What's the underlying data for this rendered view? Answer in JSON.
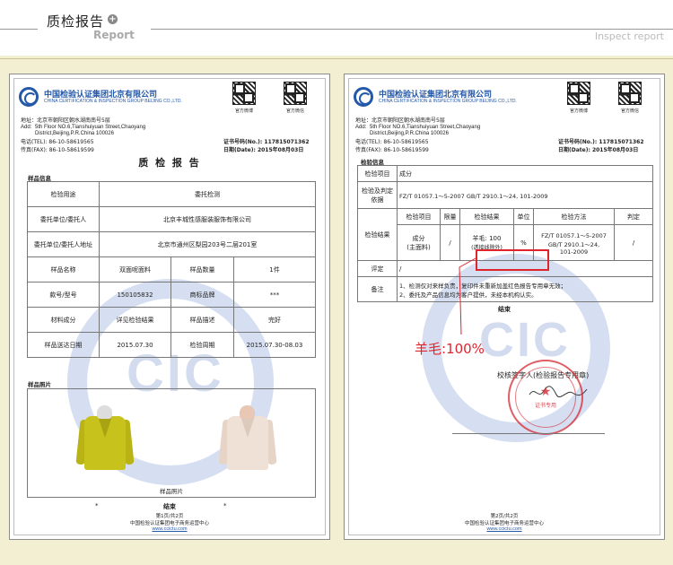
{
  "header": {
    "title": "质检报告",
    "subtitle": "Report",
    "right_label": "Inspect report",
    "plus_glyph": "+"
  },
  "org": {
    "name_cn": "中国检验认证集团北京有限公司",
    "name_en": "CHINA CERTIFICATION & INSPECTION GROUP BEIJING CO.,LTD.",
    "address_cn": "地址：北京市朝阳区朝水湖南南号5层",
    "address_label": "Add:",
    "address_en_1": "5th Floor NO.6,Tianshuiyuan Street,Chaoyang",
    "address_en_2": "District,Beijing,P.R.China   100026",
    "tel": "电话(TEL):   86-10-58619565",
    "fax": "传真(FAX):   86-10-58619599",
    "cert_no": "证书号码(No.): 117815071362",
    "date": "日期(Date): 2015年08月03日",
    "qr1_caption": "官方微博",
    "qr2_caption": "官方微信",
    "watermark": "CIC"
  },
  "report_left": {
    "title": "质 检 报 告",
    "section_info": "样品信息",
    "rows": {
      "purpose_label": "检验用途",
      "purpose_value": "委托检测",
      "client_label": "委托单位/委托人",
      "client_value": "北京丰城性感服装服饰有限公司",
      "address_label": "委托单位/委托人地址",
      "address_value": "北京市通州区梨园203号二层201室",
      "sample_label": "样品名称",
      "sample_value": "双面呢面料",
      "qty_label": "样品数量",
      "qty_value": "1件",
      "model_label": "款号/型号",
      "model_value": "150105832",
      "brand_label": "商标品牌",
      "brand_value": "***",
      "material_label": "材料成分",
      "material_value": "详见检验结果",
      "desc_label": "样品描述",
      "desc_value": "完好",
      "sent_label": "样品送达日期",
      "sent_value": "2015.07.30",
      "period_label": "检验周期",
      "period_value": "2015.07.30-08.03"
    },
    "section_photo": "样品照片",
    "photo_caption": "样品照片",
    "end_mark": "结束",
    "dots": "*",
    "footer_page": "第1页/共2页",
    "footer_org": "中国检验认证集团电子商务运营中心",
    "footer_url": "www.ccictu.com"
  },
  "report_right": {
    "section_info": "检验信息",
    "item_label": "检验项目",
    "item_value": "成分",
    "basis_label": "检验及判定依据",
    "basis_value": "FZ/T 01057.1～5-2007      GB/T 2910.1～24,    101-2009",
    "result_label": "检验结果",
    "head_item": "检验项目",
    "head_limit": "限量",
    "head_result": "检验结果",
    "head_unit": "单位",
    "head_method": "检验方法",
    "head_judge": "判定",
    "row_item_1": "成分",
    "row_item_2": "(主面料)",
    "row_limit": "/",
    "row_result_1": "羊毛: 100",
    "row_result_2": "(透接线除外)",
    "row_unit": "%",
    "row_method_1": "FZ/T 01057.1～5-2007",
    "row_method_2": "GB/T 2910.1～24,",
    "row_method_3": "101-2009",
    "row_judge": "/",
    "comment_label": "评定",
    "comment_value": "/",
    "note_label": "备注",
    "note_1": "1、检测仅对来样负责，复印件未重新加盖红色报告专用章无效；",
    "note_2": "2、委托及产品信息均为客户提供，未经本机构认实。",
    "end_mark": "结束",
    "annotation": "羊毛:100%",
    "signoff": "校核签字人(检验报告专用章)",
    "stamp_line": "证书专用",
    "footer_page": "第2页/共2页",
    "footer_org": "中国检验认证集团电子商务运营中心",
    "footer_url": "www.ccictu.com"
  },
  "colors": {
    "stage": "#f3efd3",
    "brand": "#2458a8",
    "highlight": "#e0242d",
    "coat1": "#c8c21d",
    "coat2": "#efe1d6"
  }
}
